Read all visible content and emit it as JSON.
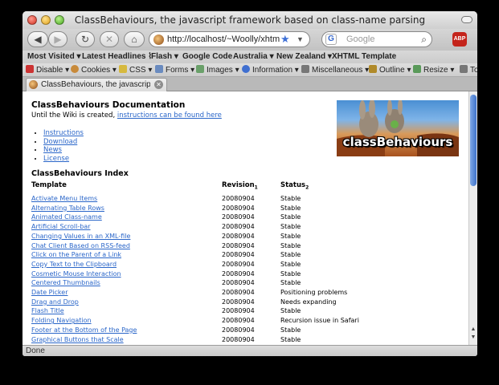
{
  "window": {
    "title": "ClassBehaviours, the javascript framework based on class-name parsing"
  },
  "navbar": {
    "back": "◀",
    "forward": "▶",
    "reload": "↻",
    "stop": "✕",
    "home": "⌂",
    "url": "http://localhost/~Woolly/xhtml/ir",
    "search_placeholder": "Google",
    "adblock": "ABP"
  },
  "bookmarks": [
    "Most Visited ▾",
    "Latest Headlines ⌇",
    "Flash ▾",
    "Google Code",
    "Australia ▾",
    "New Zealand ▾",
    "XHTML Template"
  ],
  "devbar": [
    {
      "label": "Disable ▾",
      "color": "#c33"
    },
    {
      "label": "Cookies ▾",
      "color": "#c88a3a"
    },
    {
      "label": "CSS ▾",
      "color": "#d6b93f"
    },
    {
      "label": "Forms ▾",
      "color": "#6a8bbf"
    },
    {
      "label": "Images ▾",
      "color": "#6aa06a"
    },
    {
      "label": "Information ▾",
      "color": "#3f6fd0"
    },
    {
      "label": "Miscellaneous ▾",
      "color": "#777"
    },
    {
      "label": "Outline ▾",
      "color": "#b08a2a"
    },
    {
      "label": "Resize ▾",
      "color": "#5a9a5a"
    },
    {
      "label": "To",
      "color": "#777"
    }
  ],
  "tab": {
    "title": "ClassBehaviours, the javascript..."
  },
  "doc": {
    "heading": "ClassBehaviours Documentation",
    "intro_prefix": "Until the Wiki is created, ",
    "intro_link": "instructions can be found here",
    "links": [
      "Instructions",
      "Download",
      "News",
      "License"
    ],
    "logo_text": "classBehaviours",
    "index_heading": "ClassBehaviours Index",
    "columns": {
      "template": "Template",
      "revision": "Revision",
      "revision_sub": "1",
      "status": "Status",
      "status_sub": "2"
    },
    "rows": [
      {
        "template": "Activate Menu Items",
        "revision": "20080904",
        "status": "Stable"
      },
      {
        "template": "Alternating Table Rows",
        "revision": "20080904",
        "status": "Stable"
      },
      {
        "template": "Animated Class-name",
        "revision": "20080904",
        "status": "Stable"
      },
      {
        "template": "Artificial Scroll-bar",
        "revision": "20080904",
        "status": "Stable"
      },
      {
        "template": "Changing Values in an XML-file",
        "revision": "20080904",
        "status": "Stable"
      },
      {
        "template": "Chat Client Based on RSS-feed",
        "revision": "20080904",
        "status": "Stable"
      },
      {
        "template": "Click on the Parent of a Link",
        "revision": "20080904",
        "status": "Stable"
      },
      {
        "template": "Copy Text to the Clipboard",
        "revision": "20080904",
        "status": "Stable"
      },
      {
        "template": "Cosmetic Mouse Interaction",
        "revision": "20080904",
        "status": "Stable"
      },
      {
        "template": "Centered Thumbnails",
        "revision": "20080904",
        "status": "Stable"
      },
      {
        "template": "Date Picker",
        "revision": "20080904",
        "status": "Positioning problems"
      },
      {
        "template": "Drag and Drop",
        "revision": "20080904",
        "status": "Needs expanding"
      },
      {
        "template": "Flash Title",
        "revision": "20080904",
        "status": "Stable"
      },
      {
        "template": "Folding Navigation",
        "revision": "20080904",
        "status": "Recursion issue in Safari"
      },
      {
        "template": "Footer at the Bottom of the Page",
        "revision": "20080904",
        "status": "Stable"
      },
      {
        "template": "Graphical Buttons that Scale",
        "revision": "20080904",
        "status": "Stable"
      }
    ]
  },
  "status": "Done"
}
